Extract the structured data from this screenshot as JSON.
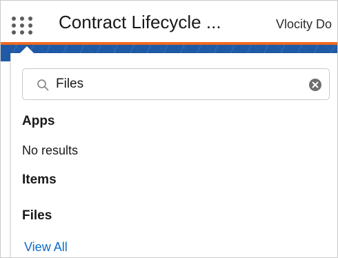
{
  "header": {
    "app_name": "Contract Lifecycle ...",
    "tab_label": "Vlocity Do",
    "launcher_icon": "app-launcher-grid-icon"
  },
  "colors": {
    "brand_band": "#1f5aa6",
    "brand_accent": "#ee6b20",
    "link": "#0b6cc8"
  },
  "search": {
    "value": "Files",
    "placeholder": "",
    "search_icon": "search-icon",
    "clear_icon": "clear-icon"
  },
  "results": {
    "apps": {
      "heading": "Apps",
      "empty_text": "No results"
    },
    "items": {
      "heading": "Items"
    },
    "files": {
      "heading": "Files",
      "view_all_label": "View All"
    }
  }
}
